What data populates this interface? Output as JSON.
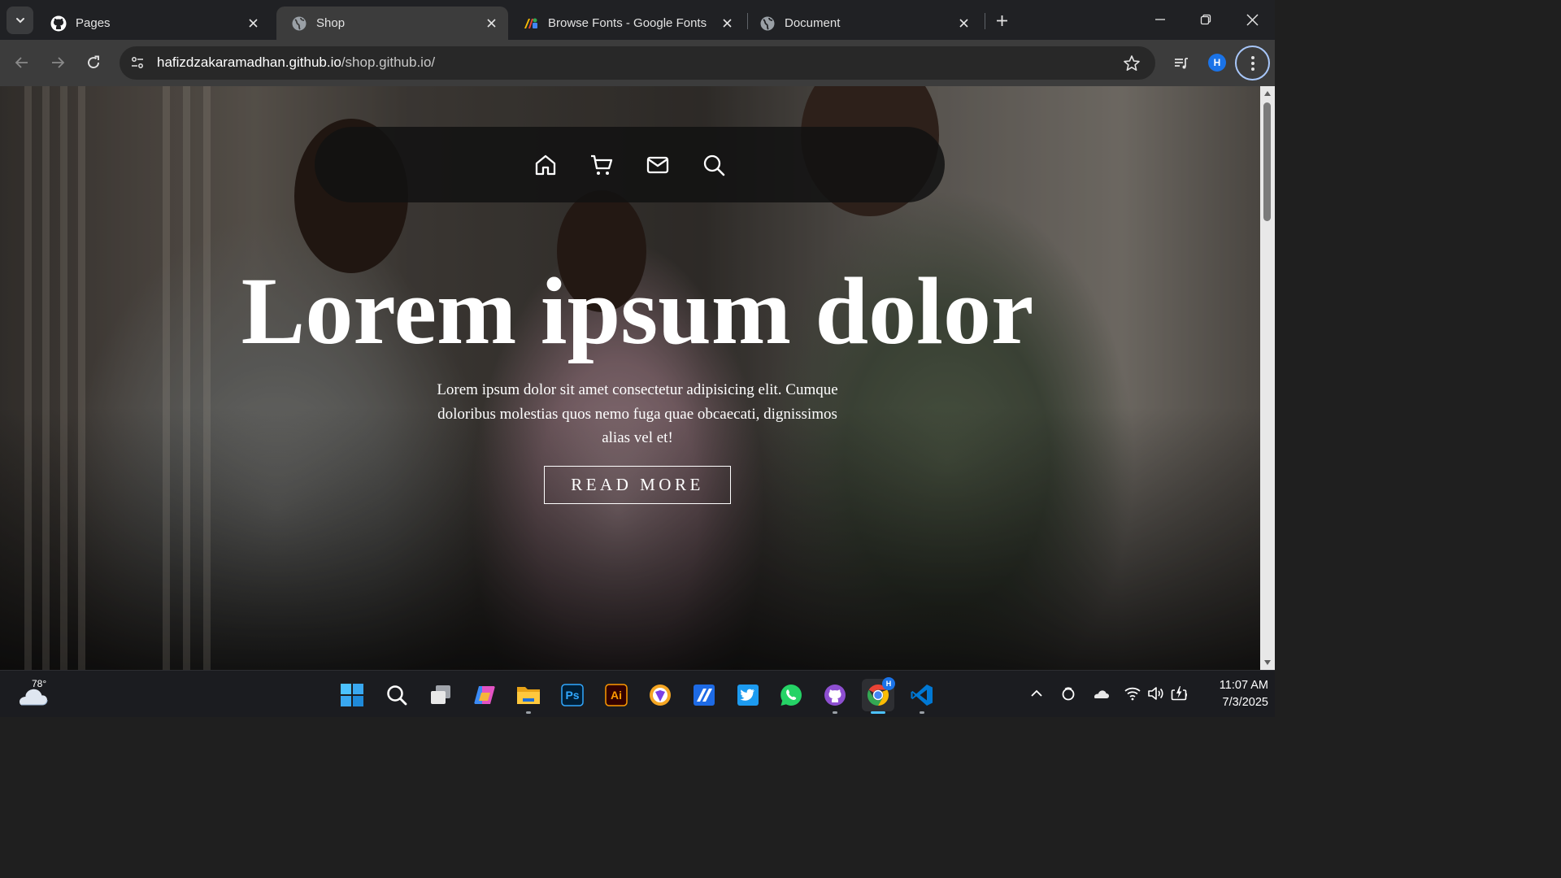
{
  "browser": {
    "tabs": [
      {
        "title": "Pages",
        "icon": "github-icon",
        "active": false
      },
      {
        "title": "Shop",
        "icon": "globe-icon",
        "active": true
      },
      {
        "title": "Browse Fonts - Google Fonts",
        "icon": "google-fonts-icon",
        "active": false
      },
      {
        "title": "Document",
        "icon": "globe-icon",
        "active": false
      }
    ],
    "url_host": "hafizdzakaramadhan.github.io",
    "url_path": "/shop.github.io/",
    "profile_initial": "H",
    "accent_color": "#a8c7fa"
  },
  "page": {
    "nav_icons": [
      "home-icon",
      "cart-icon",
      "mail-icon",
      "search-icon"
    ],
    "hero": {
      "title": "Lorem ipsum dolor",
      "text": "Lorem ipsum dolor sit amet consectetur adipisicing elit. Cumque doloribus molestias quos nemo fuga quae obcaecati, dignissimos alias vel et!",
      "button_label": "READ MORE"
    }
  },
  "taskbar": {
    "weather_temp": "78°",
    "apps": [
      "start-icon",
      "search-icon",
      "task-view-icon",
      "copilot-icon",
      "file-explorer-icon",
      "photoshop-icon",
      "illustrator-icon",
      "brave-icon",
      "dev-app-icon",
      "twitter-icon",
      "whatsapp-icon",
      "github-desktop-icon",
      "chrome-icon",
      "vscode-icon"
    ],
    "ps_label": "Ps",
    "ai_label": "Ai",
    "chrome_badge": "H",
    "time": "11:07 AM",
    "date": "7/3/2025"
  }
}
